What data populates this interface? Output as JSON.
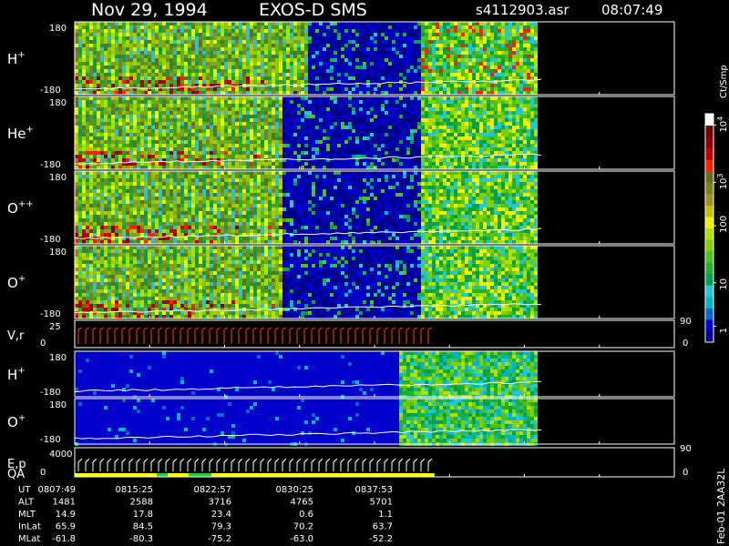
{
  "header": {
    "date": "Nov 29, 1994",
    "instrument": "EXOS-D SMS",
    "file": "s4112903.asr",
    "time": "08:07:49"
  },
  "colors": {
    "background": "#000000",
    "axes": "#ffffff",
    "velocity_trace": "#e0301e",
    "qa_good": "#ffff00",
    "qa_flag": "#22cc44"
  },
  "chart_data": {
    "type": "heatmap",
    "panels": [
      {
        "id": "h-plus-pitch",
        "label": "H",
        "superscript": "+",
        "ymin_label": "-180",
        "ymax_label": "180",
        "data_end_frac": 0.77,
        "band_sep": 8,
        "band_strength": 1.0,
        "fade_at": 0.5
      },
      {
        "id": "he-plus-pitch",
        "label": "He",
        "superscript": "+",
        "ymin_label": "-180",
        "ymax_label": "180",
        "data_end_frac": 0.77,
        "band_sep": 8,
        "band_strength": 0.9,
        "fade_at": 0.45
      },
      {
        "id": "o-plusplus-pitch",
        "label": "O",
        "superscript": "++",
        "ymin_label": "-180",
        "ymax_label": "180",
        "data_end_frac": 0.77,
        "band_sep": 8,
        "band_strength": 0.85,
        "fade_at": 0.45
      },
      {
        "id": "o-plus-pitch",
        "label": "O",
        "superscript": "+",
        "ymin_label": "-180",
        "ymax_label": "180",
        "data_end_frac": 0.77,
        "band_sep": 8,
        "band_strength": 0.85,
        "fade_at": 0.45
      },
      {
        "id": "velocity",
        "label": "V,r",
        "superscript": "",
        "ymin_label": "0",
        "ymax_label": "25",
        "right_top": "90",
        "right_bottom": "0"
      },
      {
        "id": "h-plus-2",
        "label": "H",
        "superscript": "+",
        "ymin_label": "-180",
        "ymax_label": "180",
        "data_end_frac": 0.77,
        "band_sep": 0,
        "band_strength": 0.0,
        "fade_at": 0.0
      },
      {
        "id": "o-plus-2",
        "label": "O",
        "superscript": "+",
        "ymin_label": "-180",
        "ymax_label": "180",
        "data_end_frac": 0.77,
        "band_sep": 0,
        "band_strength": 0.0,
        "fade_at": 0.0
      },
      {
        "id": "energy-qa",
        "label": "E,p",
        "label2": "QA",
        "superscript": "",
        "ymin_label": "0",
        "ymax_label": "4000",
        "right_top": "90",
        "right_bottom": "0"
      }
    ],
    "colorbar": {
      "unit_label": "Ct/Smp",
      "ticks": [
        "1",
        "10",
        "100",
        "10",
        "10"
      ],
      "tick_superscripts": [
        "",
        "",
        "",
        "3",
        "4"
      ],
      "colors": [
        "#00008b",
        "#0000c8",
        "#0066cc",
        "#00b4c8",
        "#22c8d0",
        "#00a050",
        "#20b030",
        "#50c020",
        "#80d000",
        "#b0e000",
        "#f0f000",
        "#c0c000",
        "#a09020",
        "#808020",
        "#6b6b18",
        "#ff2000",
        "#c00000",
        "#900000",
        "#700000",
        "#ffffff"
      ]
    },
    "time_axis": {
      "rows": [
        {
          "label": "UT",
          "values": [
            "0807:49",
            "0815:25",
            "0822:57",
            "0830:25",
            "0837:53"
          ]
        },
        {
          "label": "ALT",
          "values": [
            "1481",
            "2588",
            "3716",
            "4765",
            "5701"
          ]
        },
        {
          "label": "MLT",
          "values": [
            "14.9",
            "17.8",
            "23.4",
            "0.6",
            "1.1"
          ]
        },
        {
          "label": "InLat",
          "values": [
            "65.9",
            "84.5",
            "79.3",
            "70.2",
            "63.7"
          ]
        },
        {
          "label": "MLat",
          "values": [
            "-61.8",
            "-80.3",
            "-75.2",
            "-63.0",
            "-52.2"
          ]
        }
      ]
    },
    "side_label": "Feb-01 2AA32L"
  }
}
